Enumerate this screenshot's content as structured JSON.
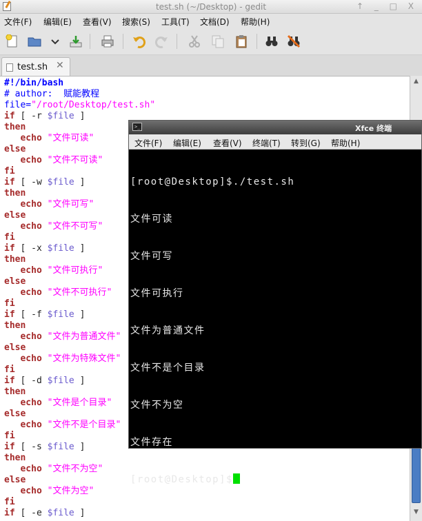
{
  "window": {
    "title": "test.sh (~/Desktop) - gedit",
    "controls": "↑ _ □ X"
  },
  "menubar": [
    "文件(F)",
    "编辑(E)",
    "查看(V)",
    "搜索(S)",
    "工具(T)",
    "文档(D)",
    "帮助(H)"
  ],
  "toolbar": {
    "icons": [
      "new-document-icon",
      "open-folder-icon",
      "open-dropdown-icon",
      "save-download-icon",
      "print-icon",
      "undo-icon",
      "redo-icon",
      "cut-icon",
      "copy-icon",
      "paste-icon",
      "find-icon",
      "replace-icon"
    ]
  },
  "tab": {
    "title": "test.sh",
    "close": "✕"
  },
  "editor": {
    "lines": [
      "#!/bin/bash",
      "# author:  赋能教程",
      "file=\"/root/Desktop/test.sh\"",
      "if [ -r $file ]",
      "then",
      "   echo \"文件可读\"",
      "else",
      "   echo \"文件不可读\"",
      "fi",
      "if [ -w $file ]",
      "then",
      "   echo \"文件可写\"",
      "else",
      "   echo \"文件不可写\"",
      "fi",
      "if [ -x $file ]",
      "then",
      "   echo \"文件可执行\"",
      "else",
      "   echo \"文件不可执行\"",
      "fi",
      "if [ -f $file ]",
      "then",
      "   echo \"文件为普通文件\"",
      "else",
      "   echo \"文件为特殊文件\"",
      "fi",
      "if [ -d $file ]",
      "then",
      "   echo \"文件是个目录\"",
      "else",
      "   echo \"文件不是个目录\"",
      "fi",
      "if [ -s $file ]",
      "then",
      "   echo \"文件不为空\"",
      "else",
      "   echo \"文件为空\"",
      "fi",
      "if [ -e $file ]"
    ]
  },
  "terminal": {
    "title": "Xfce 终端",
    "menu": [
      "文件(F)",
      "编辑(E)",
      "查看(V)",
      "终端(T)",
      "转到(G)",
      "帮助(H)"
    ],
    "lines": [
      "[root@Desktop]$./test.sh",
      "文件可读",
      "文件可写",
      "文件可执行",
      "文件为普通文件",
      "文件不是个目录",
      "文件不为空",
      "文件存在"
    ],
    "prompt": "[root@Desktop]$",
    "cursor_color": "#00e000"
  },
  "colors": {
    "keyword": "#a52a2a",
    "comment": "#0000ff",
    "string": "#ff00ff",
    "variable": "#6a5acd",
    "scrollbar_thumb": "#4b7dc4"
  }
}
